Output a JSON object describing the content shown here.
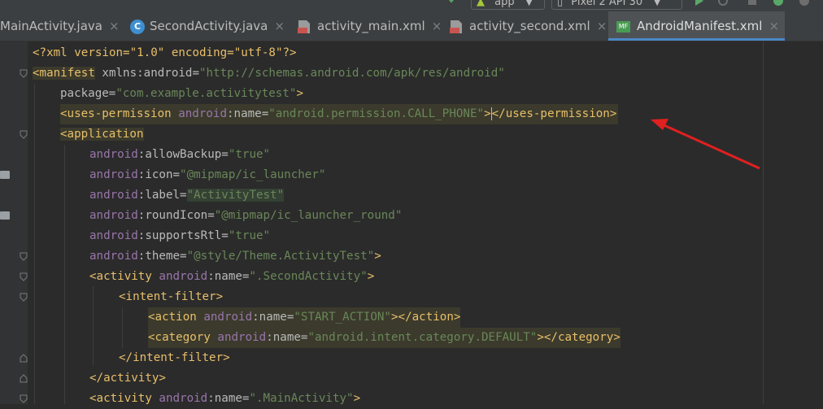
{
  "toolbar": {
    "run_config": "app",
    "device": "Pixel 2 API 30"
  },
  "tabs": [
    {
      "label": "MainActivity.java",
      "icon": "class-icon",
      "active": false
    },
    {
      "label": "SecondActivity.java",
      "icon": "class-icon",
      "active": false
    },
    {
      "label": "activity_main.xml",
      "icon": "xml-layout-icon",
      "active": false
    },
    {
      "label": "activity_second.xml",
      "icon": "xml-layout-icon",
      "active": false
    },
    {
      "label": "AndroidManifest.xml",
      "icon": "manifest-icon",
      "active": true
    }
  ],
  "icons": {
    "class_letter": "C",
    "close": "×",
    "manifest_badge": "MF"
  },
  "code": {
    "l1": "<?xml version=\"1.0\" encoding=\"utf-8\"?>",
    "l2_tag": "<manifest",
    "l2_attr": " xmlns:android=",
    "l2_val": "\"http://schemas.android.com/apk/res/android\"",
    "l3_attr": "package=",
    "l3_val": "\"com.example.activitytest\"",
    "l3_end": ">",
    "l4_open": "<uses-permission ",
    "l4_ns": "android",
    "l4_attr": ":name=",
    "l4_val": "\"android.permission.CALL_PHONE\"",
    "l4_gt": ">",
    "l4_close": "</uses-permission>",
    "l5": "<application",
    "l6_ns": "android",
    "l6_attr": ":allowBackup=",
    "l6_val": "\"true\"",
    "l7_ns": "android",
    "l7_attr": ":icon=",
    "l7_val": "\"@mipmap/ic_launcher\"",
    "l8_ns": "android",
    "l8_attr": ":label=",
    "l8_val": "\"ActivityTest\"",
    "l9_ns": "android",
    "l9_attr": ":roundIcon=",
    "l9_val": "\"@mipmap/ic_launcher_round\"",
    "l10_ns": "android",
    "l10_attr": ":supportsRtl=",
    "l10_val": "\"true\"",
    "l11_ns": "android",
    "l11_attr": ":theme=",
    "l11_val": "\"@style/Theme.ActivityTest\"",
    "l11_end": ">",
    "l12_tag": "<activity ",
    "l12_ns": "android",
    "l12_attr": ":name=",
    "l12_val": "\".SecondActivity\"",
    "l12_end": ">",
    "l13": "<intent-filter>",
    "l14_tag": "<action ",
    "l14_ns": "android",
    "l14_attr": ":name=",
    "l14_val": "\"START_ACTION\"",
    "l14_end": "></action>",
    "l15_tag": "<category ",
    "l15_ns": "android",
    "l15_attr": ":name=",
    "l15_val": "\"android.intent.category.DEFAULT\"",
    "l15_end": "></category>",
    "l16": "</intent-filter>",
    "l17": "</activity>",
    "l18_tag": "<activity ",
    "l18_ns": "android",
    "l18_attr": ":name=",
    "l18_val": "\".MainActivity\"",
    "l18_end": ">"
  },
  "colors": {
    "tag": "#e8bf6a",
    "attribute": "#bababa",
    "namespace": "#9876aa",
    "string": "#6a8759",
    "active_tab": "#4e5254",
    "arrow": "#e02020"
  }
}
